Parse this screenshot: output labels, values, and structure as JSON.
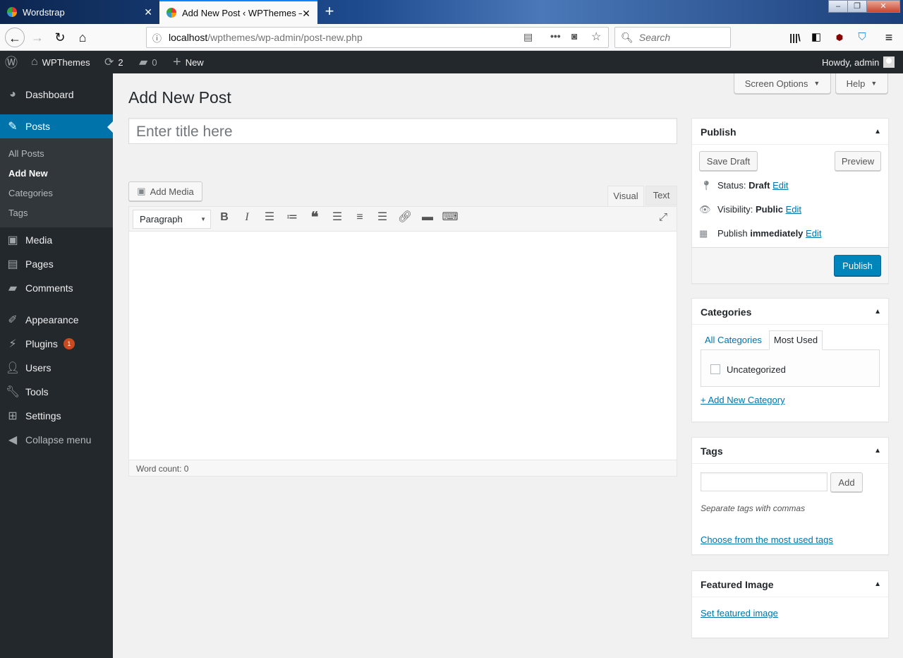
{
  "browser": {
    "tabs": [
      {
        "title": "Wordstrap"
      },
      {
        "title": "Add New Post ‹ WPThemes —"
      }
    ],
    "url_host": "localhost",
    "url_path": "/wpthemes/wp-admin/post-new.php",
    "search_placeholder": "Search"
  },
  "adminbar": {
    "site_name": "WPThemes",
    "updates_count": "2",
    "comments_count": "0",
    "new_label": "New",
    "howdy": "Howdy, admin"
  },
  "sidebar": {
    "items": [
      {
        "label": "Dashboard",
        "icon": "dashboard-icon"
      },
      {
        "label": "Posts",
        "icon": "pin-icon"
      },
      {
        "label": "Media",
        "icon": "media-icon"
      },
      {
        "label": "Pages",
        "icon": "pages-icon"
      },
      {
        "label": "Comments",
        "icon": "comments-icon"
      },
      {
        "label": "Appearance",
        "icon": "brush-icon"
      },
      {
        "label": "Plugins",
        "icon": "plugin-icon",
        "badge": "1"
      },
      {
        "label": "Users",
        "icon": "users-icon"
      },
      {
        "label": "Tools",
        "icon": "wrench-icon"
      },
      {
        "label": "Settings",
        "icon": "settings-icon"
      },
      {
        "label": "Collapse menu",
        "icon": "collapse-icon"
      }
    ],
    "submenu": [
      "All Posts",
      "Add New",
      "Categories",
      "Tags"
    ]
  },
  "screen": {
    "screen_options": "Screen Options",
    "help": "Help"
  },
  "page_title": "Add New Post",
  "title_placeholder": "Enter title here",
  "editor": {
    "add_media": "Add Media",
    "tab_visual": "Visual",
    "tab_text": "Text",
    "format_select": "Paragraph",
    "word_count": "Word count: 0"
  },
  "publish": {
    "title": "Publish",
    "save_draft": "Save Draft",
    "preview": "Preview",
    "status_label": "Status:",
    "status_value": "Draft",
    "visibility_label": "Visibility:",
    "visibility_value": "Public",
    "publish_label": "Publish",
    "publish_value": "immediately",
    "edit": "Edit",
    "publish_button": "Publish"
  },
  "categories": {
    "title": "Categories",
    "tab_all": "All Categories",
    "tab_most": "Most Used",
    "item": "Uncategorized",
    "add_new": "+ Add New Category"
  },
  "tags": {
    "title": "Tags",
    "add": "Add",
    "hint": "Separate tags with commas",
    "choose": "Choose from the most used tags"
  },
  "featured": {
    "title": "Featured Image",
    "set": "Set featured image"
  },
  "colors": {
    "admin_dark": "#23282d",
    "accent": "#0073aa",
    "primary_button": "#0085ba",
    "badge": "#ca4a1f"
  }
}
